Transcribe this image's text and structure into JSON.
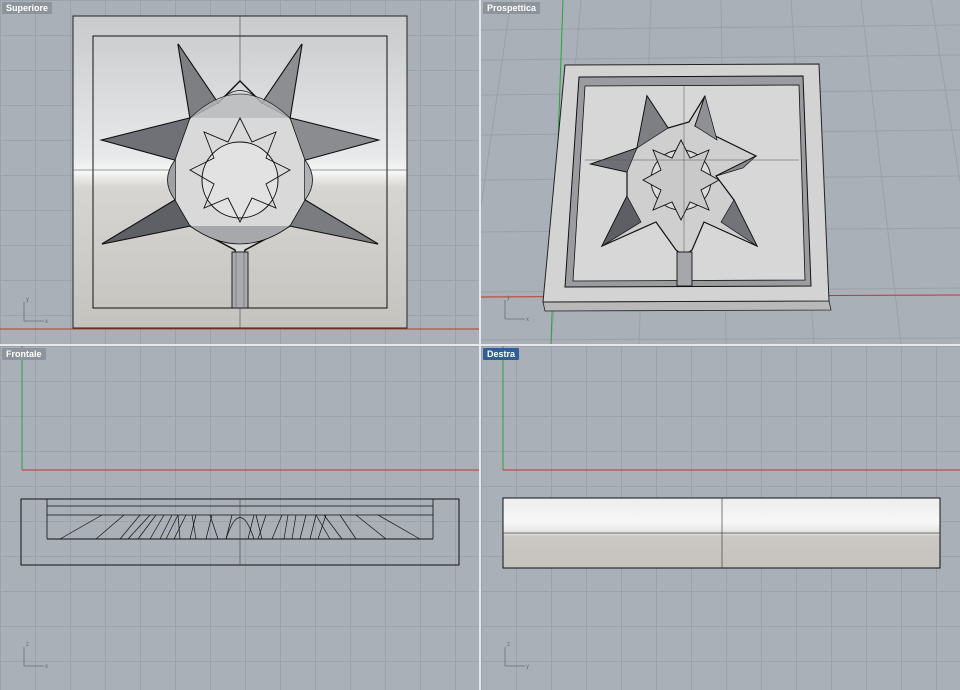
{
  "viewports": [
    {
      "id": "top",
      "title": "Superiore",
      "active": false
    },
    {
      "id": "perspective",
      "title": "Prospettica",
      "active": false
    },
    {
      "id": "front",
      "title": "Frontale",
      "active": false
    },
    {
      "id": "right",
      "title": "Destra",
      "active": true
    }
  ],
  "axes": {
    "x": "x",
    "y": "y",
    "z": "z"
  },
  "colors": {
    "viewport_bg": "#a9b0b8",
    "grid_line": "#9ba2ab",
    "x_axis": "#c0392b",
    "y_axis": "#27a33a",
    "active_title": "#2f5f95",
    "inactive_title": "#8d949c",
    "model_surface": "#d8d8d8"
  }
}
